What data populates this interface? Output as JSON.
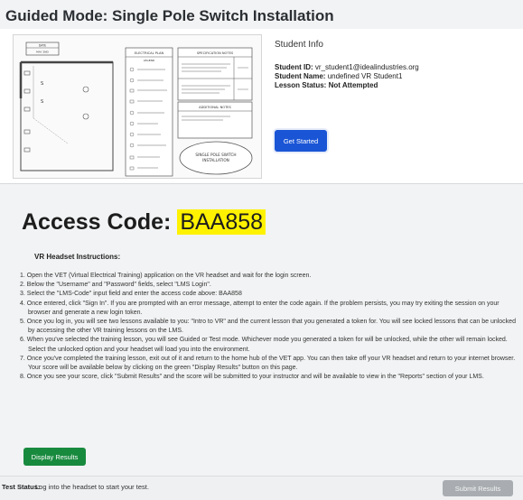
{
  "page": {
    "title": "Guided Mode: Single Pole Switch Installation"
  },
  "plan": {
    "date_label": "DATE",
    "date_value": "MAY 2ND",
    "electrical_plan": "ELECTRICAL PLAN",
    "legend": "LEGEND",
    "spec_notes": "SPECIFICATION NOTES",
    "additional_notes": "ADDITIONAL NOTES",
    "installation_label_1": "SINGLE POLE SWITCH",
    "installation_label_2": "INSTALLATION"
  },
  "student": {
    "header": "Student Info",
    "id_label": "Student ID:",
    "id_value": "vr_student1@idealindustries.org",
    "name_label": "Student Name:",
    "name_value": "undefined VR Student1",
    "status_label": "Lesson Status:",
    "status_value": "Not Attempted",
    "start_button": "Get Started"
  },
  "access": {
    "label": "Access Code:",
    "code": "BAA858"
  },
  "instructions": {
    "title": "VR Headset Instructions:",
    "steps": [
      "1. Open the VET (Virtual Electrical Training) application on the VR headset and wait for the login screen.",
      "2. Below the \"Username\" and \"Password\" fields, select \"LMS Login\".",
      "3. Select the \"LMS-Code\" input field and enter the access code above: BAA858",
      "4. Once entered, click \"Sign In\". If you are prompted with an error message, attempt to enter the code again. If the problem persists, you may try exiting the session on your browser and generate a new login token.",
      "5. Once you log in, you will see two lessons available to you: \"Intro to VR\" and the current lesson that you generated a token for. You will see locked lessons that can be unlocked by accessing the other VR training lessons on the LMS.",
      "6. When you've selected the training lesson, you will see Guided or Test mode. Whichever mode you generated a token for will be unlocked, while the other will remain locked. Select the unlocked option and your headset will load you into the environment.",
      "7. Once you've completed the training lesson, exit out of it and return to the home hub of the VET app. You can then take off your VR headset and return to your internet browser. Your score will be available below by clicking on the green \"Display Results\" button on this page.",
      "8. Once you see your score, click \"Submit Results\" and the score will be submitted to your instructor and will be available to view in the \"Reports\" section of your LMS."
    ]
  },
  "actions": {
    "display_results": "Display Results",
    "submit_results": "Submit Results"
  },
  "status": {
    "label": "Test Status:",
    "text": "Log into the headset to start your test."
  },
  "colors": {
    "primary": "#1a55d6",
    "success": "#188a3e",
    "highlight": "#fff200",
    "disabled": "#a9adb1"
  }
}
